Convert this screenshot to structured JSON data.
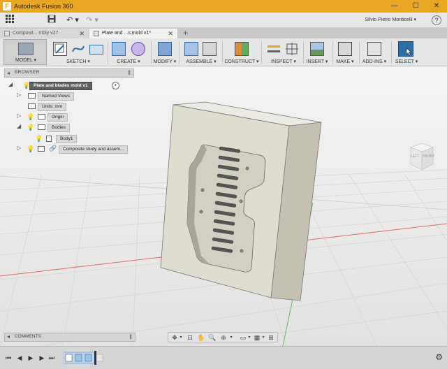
{
  "window": {
    "title": "Autodesk Fusion 360",
    "app_logo": "F",
    "controls": [
      "—",
      "☐",
      "✕"
    ]
  },
  "quickbar": {
    "user": "Silvio Pietro Monticelli ▾",
    "help": "?",
    "icons": [
      "grid-icon",
      "save-icon",
      "undo-icon",
      "redo-icon"
    ]
  },
  "tabs": [
    {
      "label": "Composit... mbly v27",
      "active": false
    },
    {
      "label": "Plate and ...s mold v1*",
      "active": true
    }
  ],
  "toolbar": {
    "workspace": "MODEL ▾",
    "groups": [
      {
        "label": "SKETCH ▾"
      },
      {
        "label": "CREATE ▾"
      },
      {
        "label": "MODIFY ▾"
      },
      {
        "label": "ASSEMBLE ▾"
      },
      {
        "label": "CONSTRUCT ▾"
      },
      {
        "label": "INSPECT ▾"
      },
      {
        "label": "INSERT ▾"
      },
      {
        "label": "MAKE ▾"
      },
      {
        "label": "ADD-INS ▾"
      },
      {
        "label": "SELECT ▾"
      }
    ]
  },
  "browser": {
    "header": "BROWSER",
    "root": "Plate and blades mold v1",
    "items": [
      {
        "label": "Named Views"
      },
      {
        "label": "Units: mm"
      },
      {
        "label": "Origin"
      },
      {
        "label": "Bodies"
      },
      {
        "label": "Body1"
      },
      {
        "label": "Composite study and assem..."
      }
    ]
  },
  "viewcube": {
    "left": "LEFT",
    "front": "FRONT"
  },
  "comments": {
    "label": "COMMENTS"
  },
  "colors": {
    "title_bar": "#e8a623",
    "mold_face": "#dfdcd0",
    "mold_side": "#c4c0b2",
    "axis_red": "#e06a6a",
    "axis_green": "#6ab86a",
    "select_blue": "#2f6fa8"
  }
}
